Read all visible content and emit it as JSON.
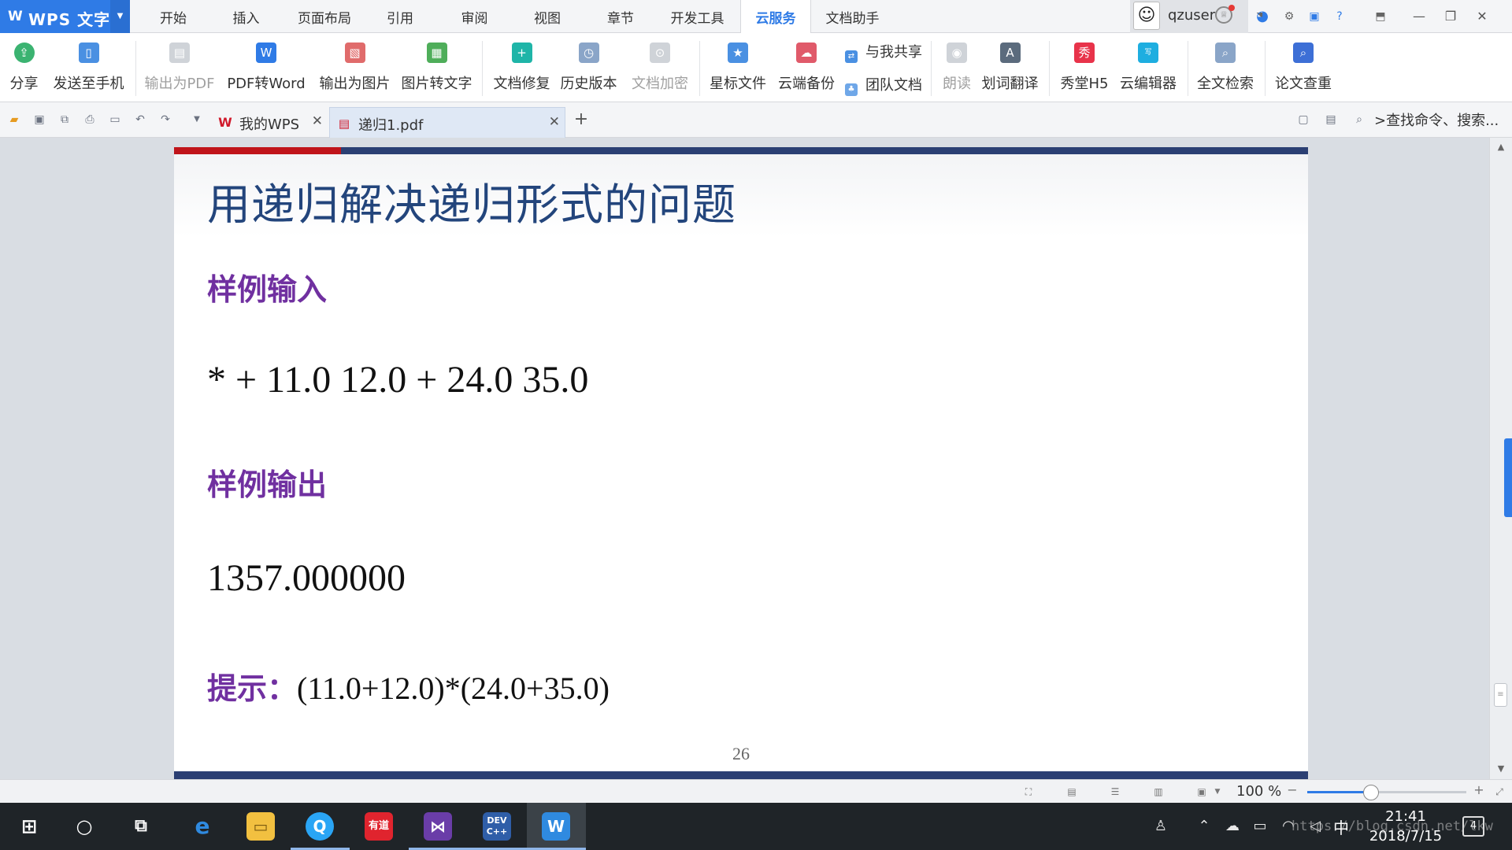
{
  "app": {
    "logo_text": "WPS 文字"
  },
  "menu": {
    "tabs": [
      "开始",
      "插入",
      "页面布局",
      "引用",
      "审阅",
      "视图",
      "章节",
      "开发工具",
      "云服务",
      "文档助手"
    ],
    "active_tab": "云服务"
  },
  "user": {
    "name": "qzuser"
  },
  "ribbon": {
    "share": "分享",
    "send_to_phone": "发送至手机",
    "export_pdf": "输出为PDF",
    "pdf_to_word": "PDF转Word",
    "export_image": "输出为图片",
    "image_to_text": "图片转文字",
    "doc_repair": "文档修复",
    "history": "历史版本",
    "doc_encrypt": "文档加密",
    "starred_files": "星标文件",
    "cloud_backup": "云端备份",
    "shared_with_me": "与我共享",
    "team_docs": "团队文档",
    "read_aloud": "朗读",
    "word_translate": "划词翻译",
    "xiutang_h5": "秀堂H5",
    "cloud_editor": "云编辑器",
    "fulltext_search": "全文检索",
    "paper_check": "论文查重"
  },
  "doc_tabs": [
    {
      "label": "我的WPS",
      "icon": "wps-logo-icon"
    },
    {
      "label": "递归1.pdf",
      "icon": "pdf-file-icon"
    }
  ],
  "search_command": ">查找命令、搜索...",
  "slide": {
    "title": "用递归解决递归形式的问题",
    "sample_input_heading": "样例输入",
    "sample_input": "* + 11.0 12.0 + 24.0 35.0",
    "sample_output_heading": "样例输出",
    "sample_output": "1357.000000",
    "hint_label": "提示：",
    "hint_expr": "(11.0+12.0)*(24.0+35.0)",
    "page_number": "26"
  },
  "status": {
    "zoom_text": "100 %",
    "zoom_level": 0.4
  },
  "taskbar": {
    "apps": [
      "start-icon",
      "cortana-icon",
      "task-view-icon",
      "edge-icon",
      "file-explorer-icon",
      "qq-browser-icon",
      "youdao-icon",
      "visual-studio-icon",
      "dev-cpp-icon",
      "wps-icon"
    ],
    "ime": "中",
    "time": "21:41",
    "date": "2018/7/15",
    "notifications": "4"
  },
  "watermark": "https://blog.csdn.net/lkw",
  "colors": {
    "accent": "#2f7be6",
    "slide_title": "#23457c",
    "heading_purple": "#7030a0",
    "slide_red": "#c0141a",
    "slide_navy": "#2b3f73"
  }
}
